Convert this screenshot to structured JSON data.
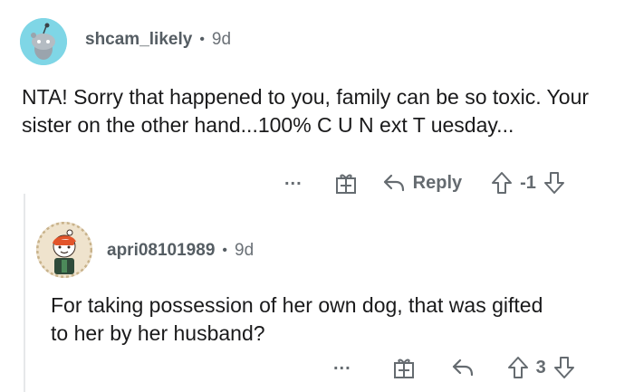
{
  "comments": [
    {
      "username": "shcam_likely",
      "separator": "•",
      "age": "9d",
      "body": "NTA! Sorry that happened to you, family can be so toxic. Your sister on the other hand...100% C U N ext T uesday...",
      "more_label": "...",
      "reply_label": "Reply",
      "score": "-1",
      "avatar_color": "#7fd6e6"
    },
    {
      "username": "apri08101989",
      "separator": "•",
      "age": "9d",
      "body": "For taking possession of her own dog, that was gifted to her by her husband?",
      "more_label": "...",
      "reply_label": "",
      "score": "3"
    }
  ],
  "colors": {
    "text": "#1a1a1b",
    "meta": "#555d63",
    "icon": "#656b70"
  }
}
